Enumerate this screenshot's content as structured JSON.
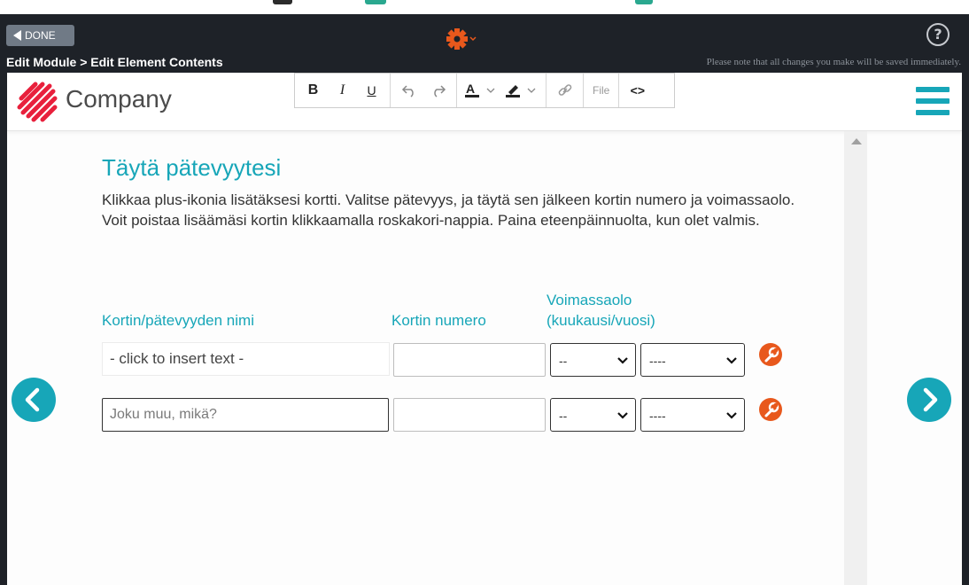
{
  "toolbar": {
    "done_label": "DONE",
    "help_label": "?",
    "breadcrumb": "Edit Module > Edit Element Contents",
    "save_note": "Please note that all changes you make will be saved immediately."
  },
  "header": {
    "company_name": "Company"
  },
  "editor": {
    "bold": "B",
    "italic": "I",
    "underline": "U",
    "file_label": "File",
    "source_label": "<>"
  },
  "content": {
    "title": "Täytä pätevyytesi",
    "paragraph1": "Klikkaa plus-ikonia lisätäksesi kortti. Valitse pätevyys, ja täytä sen jälkeen kortin numero ja voimassaolo.",
    "paragraph2": "Voit poistaa lisäämäsi kortin klikkaamalla roskakori-nappia. Paina eteenpäinnuolta, kun olet valmis.",
    "columns": {
      "name": "Kortin/pätevyyden nimi",
      "number": "Kortin numero",
      "validity_line1": "Voimassaolo",
      "validity_line2": "(kuukausi/vuosi)"
    },
    "rows": [
      {
        "name_text": "- click to insert text -",
        "number": "",
        "month": "--",
        "year": "----"
      },
      {
        "name_placeholder": "Joku muu, mikä?",
        "number": "",
        "month": "--",
        "year": "----"
      }
    ]
  },
  "colors": {
    "accent": "#17a6b8",
    "delete": "#e8581c",
    "gear": "#e8581c",
    "dark_bar": "#1e2228"
  }
}
